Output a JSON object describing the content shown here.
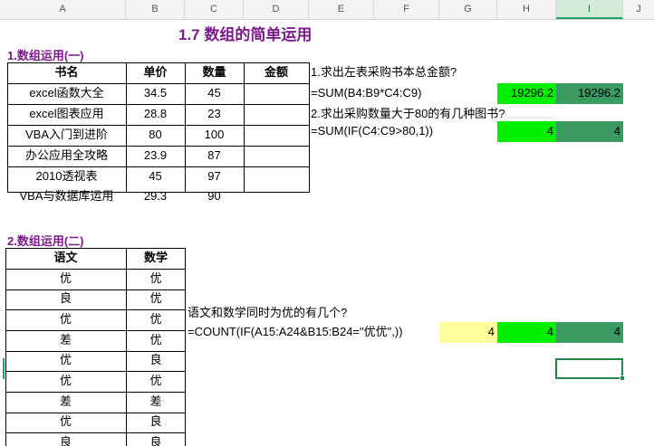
{
  "columns": [
    "A",
    "B",
    "C",
    "D",
    "E",
    "F",
    "G",
    "H",
    "I",
    "J"
  ],
  "title": "1.7 数组的简单运用",
  "section1": {
    "label": "1.数组运用(一)",
    "headers": [
      "书名",
      "单价",
      "数量",
      "金额"
    ],
    "rows": [
      [
        "excel函数大全",
        "34.5",
        "45",
        ""
      ],
      [
        "excel图表应用",
        "28.8",
        "23",
        ""
      ],
      [
        "VBA入门到进阶",
        "80",
        "100",
        ""
      ],
      [
        "办公应用全攻略",
        "23.9",
        "87",
        ""
      ],
      [
        "2010透视表",
        "45",
        "97",
        ""
      ],
      [
        "VBA与数据库运用",
        "29.3",
        "90",
        ""
      ]
    ],
    "q1": "1.求出左表采购书本总金额?",
    "f1": "=SUM(B4:B9*C4:C9)",
    "r1_h": "19296.2",
    "r1_i": "19296.2",
    "q2": "2.求出采购数量大于80的有几种图书?",
    "f2": "=SUM(IF(C4:C9>80,1))",
    "r2_h": "4",
    "r2_i": "4"
  },
  "section2": {
    "label": "2.数组运用(二)",
    "headers": [
      "语文",
      "数学"
    ],
    "rows": [
      [
        "优",
        "优"
      ],
      [
        "良",
        "优"
      ],
      [
        "优",
        "优"
      ],
      [
        "差",
        "优"
      ],
      [
        "优",
        "良"
      ],
      [
        "优",
        "优"
      ],
      [
        "差",
        "差"
      ],
      [
        "优",
        "良"
      ],
      [
        "良",
        "良"
      ],
      [
        "优",
        "优"
      ]
    ],
    "q": "语文和数学同时为优的有几个?",
    "f": "=COUNT(IF(A15:A24&B15:B24=\"优优\",))",
    "r_g": "4",
    "r_h": "4",
    "r_i": "4"
  }
}
